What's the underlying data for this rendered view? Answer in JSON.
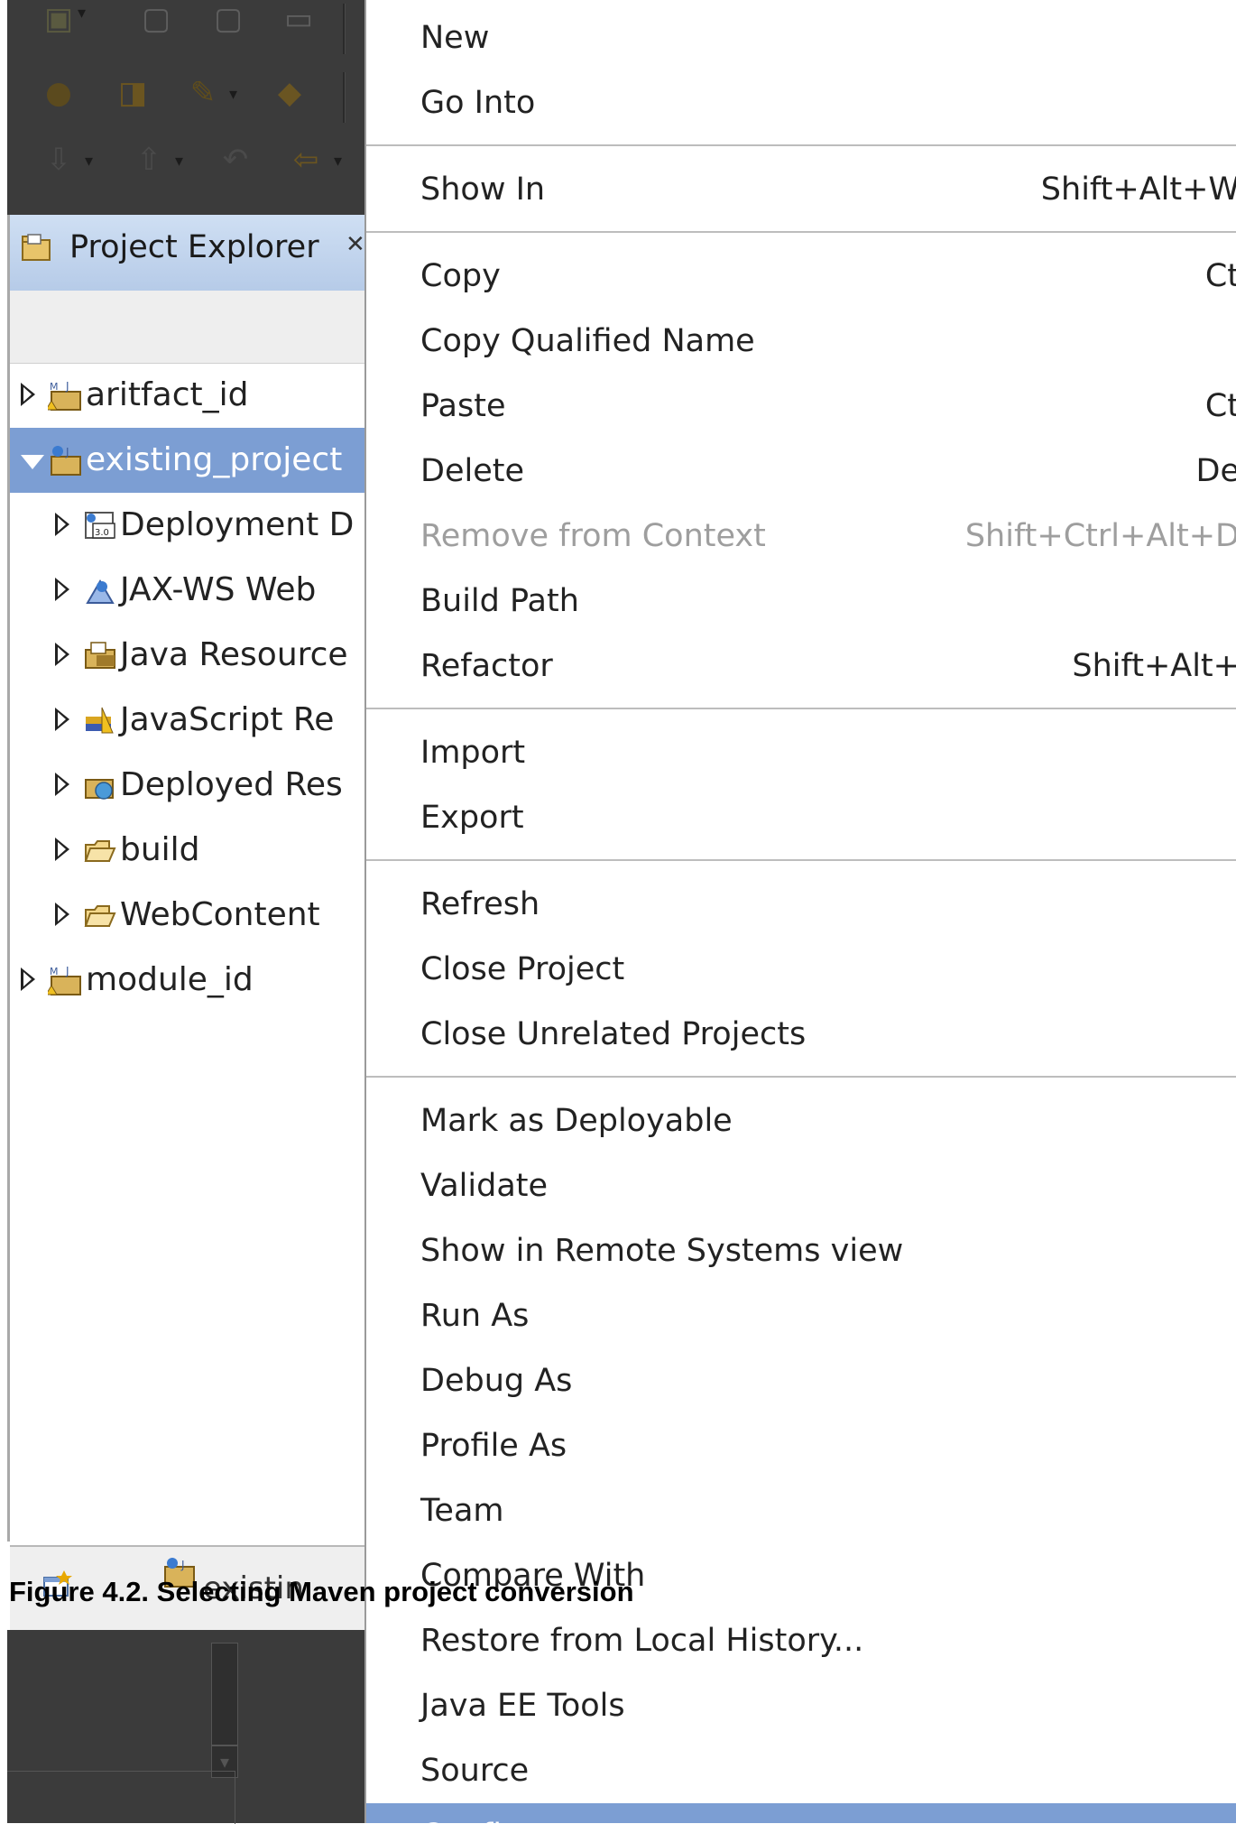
{
  "explorer": {
    "title": "Project Explorer",
    "close_glyph": "✕",
    "tree": [
      {
        "label": "aritfact_id",
        "level": 0,
        "expanded": false,
        "selected": false,
        "icon": "maven-project-icon"
      },
      {
        "label": "existing_project",
        "level": 0,
        "expanded": true,
        "selected": true,
        "icon": "web-project-icon"
      },
      {
        "label": "Deployment D",
        "level": 1,
        "expanded": false,
        "selected": false,
        "icon": "deployment-descriptor-icon"
      },
      {
        "label": "JAX-WS Web",
        "level": 1,
        "expanded": false,
        "selected": false,
        "icon": "jaxws-icon"
      },
      {
        "label": "Java Resource",
        "level": 1,
        "expanded": false,
        "selected": false,
        "icon": "java-resources-icon"
      },
      {
        "label": "JavaScript Re",
        "level": 1,
        "expanded": false,
        "selected": false,
        "icon": "javascript-resources-icon"
      },
      {
        "label": "Deployed Res",
        "level": 1,
        "expanded": false,
        "selected": false,
        "icon": "deployed-resources-icon"
      },
      {
        "label": "build",
        "level": 1,
        "expanded": false,
        "selected": false,
        "icon": "folder-icon"
      },
      {
        "label": "WebContent",
        "level": 1,
        "expanded": false,
        "selected": false,
        "icon": "folder-icon"
      },
      {
        "label": "module_id",
        "level": 0,
        "expanded": false,
        "selected": false,
        "icon": "maven-project-icon"
      }
    ],
    "bottom_tab_label": "existin"
  },
  "caption": "Figure 4.2. Selecting Maven project conversion",
  "menu": {
    "groups": [
      [
        {
          "label": "New",
          "shortcut": ""
        },
        {
          "label": "Go Into",
          "shortcut": ""
        }
      ],
      [
        {
          "label": "Show In",
          "shortcut": "Shift+Alt+W"
        }
      ],
      [
        {
          "label": "Copy",
          "shortcut": "Ct"
        },
        {
          "label": "Copy Qualified Name",
          "shortcut": ""
        },
        {
          "label": "Paste",
          "shortcut": "Ct"
        },
        {
          "label": "Delete",
          "shortcut": "De"
        },
        {
          "label": "Remove from Context",
          "shortcut": "Shift+Ctrl+Alt+D",
          "disabled": true
        },
        {
          "label": "Build Path",
          "shortcut": ""
        },
        {
          "label": "Refactor",
          "shortcut": "Shift+Alt+"
        }
      ],
      [
        {
          "label": "Import",
          "shortcut": ""
        },
        {
          "label": "Export",
          "shortcut": ""
        }
      ],
      [
        {
          "label": "Refresh",
          "shortcut": ""
        },
        {
          "label": "Close Project",
          "shortcut": ""
        },
        {
          "label": "Close Unrelated Projects",
          "shortcut": ""
        }
      ],
      [
        {
          "label": "Mark as Deployable",
          "shortcut": ""
        },
        {
          "label": "Validate",
          "shortcut": ""
        },
        {
          "label": "Show in Remote Systems view",
          "shortcut": ""
        },
        {
          "label": "Run As",
          "shortcut": ""
        },
        {
          "label": "Debug As",
          "shortcut": ""
        },
        {
          "label": "Profile As",
          "shortcut": ""
        },
        {
          "label": "Team",
          "shortcut": ""
        },
        {
          "label": "Compare With",
          "shortcut": ""
        },
        {
          "label": "Restore from Local History...",
          "shortcut": ""
        },
        {
          "label": "Java EE Tools",
          "shortcut": ""
        },
        {
          "label": "Source",
          "shortcut": ""
        },
        {
          "label": "Configure",
          "shortcut": "",
          "highlighted": true
        }
      ]
    ]
  },
  "colors": {
    "selection": "#7c9ed3",
    "disabled_text": "#9e9e9e",
    "dim_background": "#3b3b3b"
  }
}
